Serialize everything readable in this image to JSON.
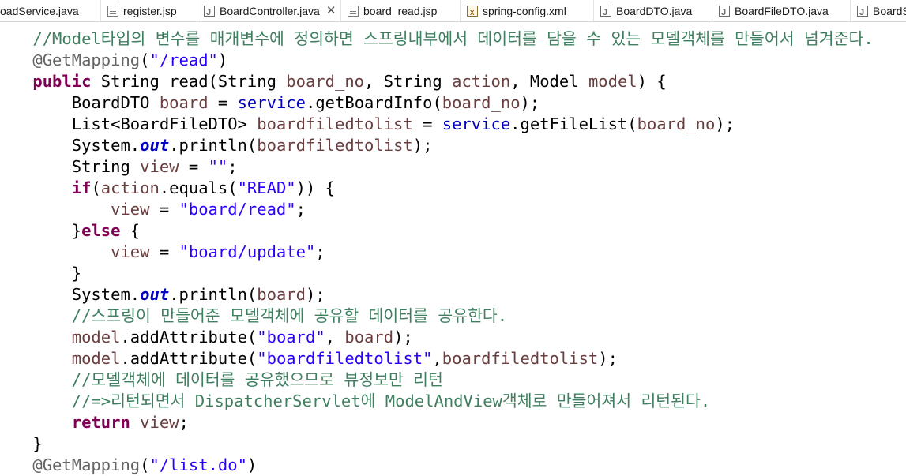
{
  "tabs": [
    {
      "label": "oadService.java",
      "icon": "java-file-icon",
      "active": false,
      "close": ""
    },
    {
      "label": "register.jsp",
      "icon": "jsp-file-icon",
      "active": false,
      "close": ""
    },
    {
      "label": "BoardController.java",
      "icon": "java-file-icon",
      "active": true,
      "close": "✕"
    },
    {
      "label": "board_read.jsp",
      "icon": "jsp-file-icon",
      "active": false,
      "close": ""
    },
    {
      "label": "spring-config.xml",
      "icon": "xml-file-icon",
      "active": false,
      "close": ""
    },
    {
      "label": "BoardDTO.java",
      "icon": "java-file-icon",
      "active": false,
      "close": ""
    },
    {
      "label": "BoardFileDTO.java",
      "icon": "java-file-icon",
      "active": false,
      "close": ""
    },
    {
      "label": "BoardS",
      "icon": "java-file-icon",
      "active": false,
      "close": ""
    }
  ],
  "colors": {
    "comment": "#3f7f5f",
    "annotation": "#646464",
    "keyword": "#7f0055",
    "string": "#2a00ff",
    "local_variable": "#6a3e3e",
    "field": "#0000c0"
  },
  "code": [
    {
      "indent": "    ",
      "tokens": [
        [
          "cm",
          "//Model타입의 변수를 매개변수에 정의하면 스프링내부에서 데이터를 담을 수 있는 모델객체를 만들어서 넘겨준다."
        ]
      ]
    },
    {
      "indent": "    ",
      "tokens": [
        [
          "an",
          "@GetMapping"
        ],
        [
          "pl",
          "("
        ],
        [
          "st",
          "\"/read\""
        ],
        [
          "pl",
          ")"
        ]
      ]
    },
    {
      "indent": "    ",
      "tokens": [
        [
          "kw",
          "public"
        ],
        [
          "pl",
          " String read(String "
        ],
        [
          "vr",
          "board_no"
        ],
        [
          "pl",
          ", String "
        ],
        [
          "vr",
          "action"
        ],
        [
          "pl",
          ", Model "
        ],
        [
          "vr",
          "model"
        ],
        [
          "pl",
          ") {"
        ]
      ]
    },
    {
      "indent": "        ",
      "tokens": [
        [
          "pl",
          "BoardDTO "
        ],
        [
          "vr",
          "board"
        ],
        [
          "pl",
          " = "
        ],
        [
          "fld",
          "service"
        ],
        [
          "pl",
          ".getBoardInfo("
        ],
        [
          "vr",
          "board_no"
        ],
        [
          "pl",
          ");"
        ]
      ]
    },
    {
      "indent": "        ",
      "tokens": [
        [
          "pl",
          "List<BoardFileDTO> "
        ],
        [
          "vr",
          "boardfiledtolist"
        ],
        [
          "pl",
          " = "
        ],
        [
          "fld",
          "service"
        ],
        [
          "pl",
          ".getFileList("
        ],
        [
          "vr",
          "board_no"
        ],
        [
          "pl",
          ");"
        ]
      ]
    },
    {
      "indent": "        ",
      "tokens": [
        [
          "pl",
          "System."
        ],
        [
          "sfld",
          "out"
        ],
        [
          "pl",
          ".println("
        ],
        [
          "vr",
          "boardfiledtolist"
        ],
        [
          "pl",
          ");"
        ]
      ]
    },
    {
      "indent": "        ",
      "tokens": [
        [
          "pl",
          "String "
        ],
        [
          "vr",
          "view"
        ],
        [
          "pl",
          " = "
        ],
        [
          "st",
          "\"\""
        ],
        [
          "pl",
          ";"
        ]
      ]
    },
    {
      "indent": "        ",
      "tokens": [
        [
          "kw",
          "if"
        ],
        [
          "pl",
          "("
        ],
        [
          "vr",
          "action"
        ],
        [
          "pl",
          ".equals("
        ],
        [
          "st",
          "\"READ\""
        ],
        [
          "pl",
          ")) {"
        ]
      ]
    },
    {
      "indent": "            ",
      "tokens": [
        [
          "vr",
          "view"
        ],
        [
          "pl",
          " = "
        ],
        [
          "st",
          "\"board/read\""
        ],
        [
          "pl",
          ";"
        ]
      ]
    },
    {
      "indent": "        ",
      "tokens": [
        [
          "pl",
          "}"
        ],
        [
          "kw",
          "else"
        ],
        [
          "pl",
          " {"
        ]
      ]
    },
    {
      "indent": "            ",
      "tokens": [
        [
          "vr",
          "view"
        ],
        [
          "pl",
          " = "
        ],
        [
          "st",
          "\"board/update\""
        ],
        [
          "pl",
          ";"
        ]
      ]
    },
    {
      "indent": "        ",
      "tokens": [
        [
          "pl",
          "}"
        ]
      ]
    },
    {
      "indent": "        ",
      "tokens": [
        [
          "pl",
          "System."
        ],
        [
          "sfld",
          "out"
        ],
        [
          "pl",
          ".println("
        ],
        [
          "vr",
          "board"
        ],
        [
          "pl",
          ");"
        ]
      ]
    },
    {
      "indent": "        ",
      "tokens": [
        [
          "cm",
          "//스프링이 만들어준 모델객체에 공유할 데이터를 공유한다."
        ]
      ]
    },
    {
      "indent": "        ",
      "tokens": [
        [
          "vr",
          "model"
        ],
        [
          "pl",
          ".addAttribute("
        ],
        [
          "st",
          "\"board\""
        ],
        [
          "pl",
          ", "
        ],
        [
          "vr",
          "board"
        ],
        [
          "pl",
          ");"
        ]
      ]
    },
    {
      "indent": "        ",
      "tokens": [
        [
          "vr",
          "model"
        ],
        [
          "pl",
          ".addAttribute("
        ],
        [
          "st",
          "\"boardfiledtolist\""
        ],
        [
          "pl",
          ","
        ],
        [
          "vr",
          "boardfiledtolist"
        ],
        [
          "pl",
          ");"
        ]
      ]
    },
    {
      "indent": "        ",
      "tokens": [
        [
          "cm",
          "//모델객체에 데이터를 공유했으므로 뷰정보만 리턴"
        ]
      ]
    },
    {
      "indent": "        ",
      "tokens": [
        [
          "cm",
          "//=>리턴되면서 DispatcherServlet에 ModelAndView객체로 만들어져서 리턴된다."
        ]
      ]
    },
    {
      "indent": "        ",
      "tokens": [
        [
          "kw",
          "return"
        ],
        [
          "pl",
          " "
        ],
        [
          "vr",
          "view"
        ],
        [
          "pl",
          ";"
        ]
      ]
    },
    {
      "indent": "    ",
      "tokens": [
        [
          "pl",
          "}"
        ]
      ]
    },
    {
      "indent": "    ",
      "tokens": [
        [
          "an",
          "@GetMapping"
        ],
        [
          "pl",
          "("
        ],
        [
          "st",
          "\"/list.do\""
        ],
        [
          "pl",
          ")"
        ]
      ]
    }
  ]
}
